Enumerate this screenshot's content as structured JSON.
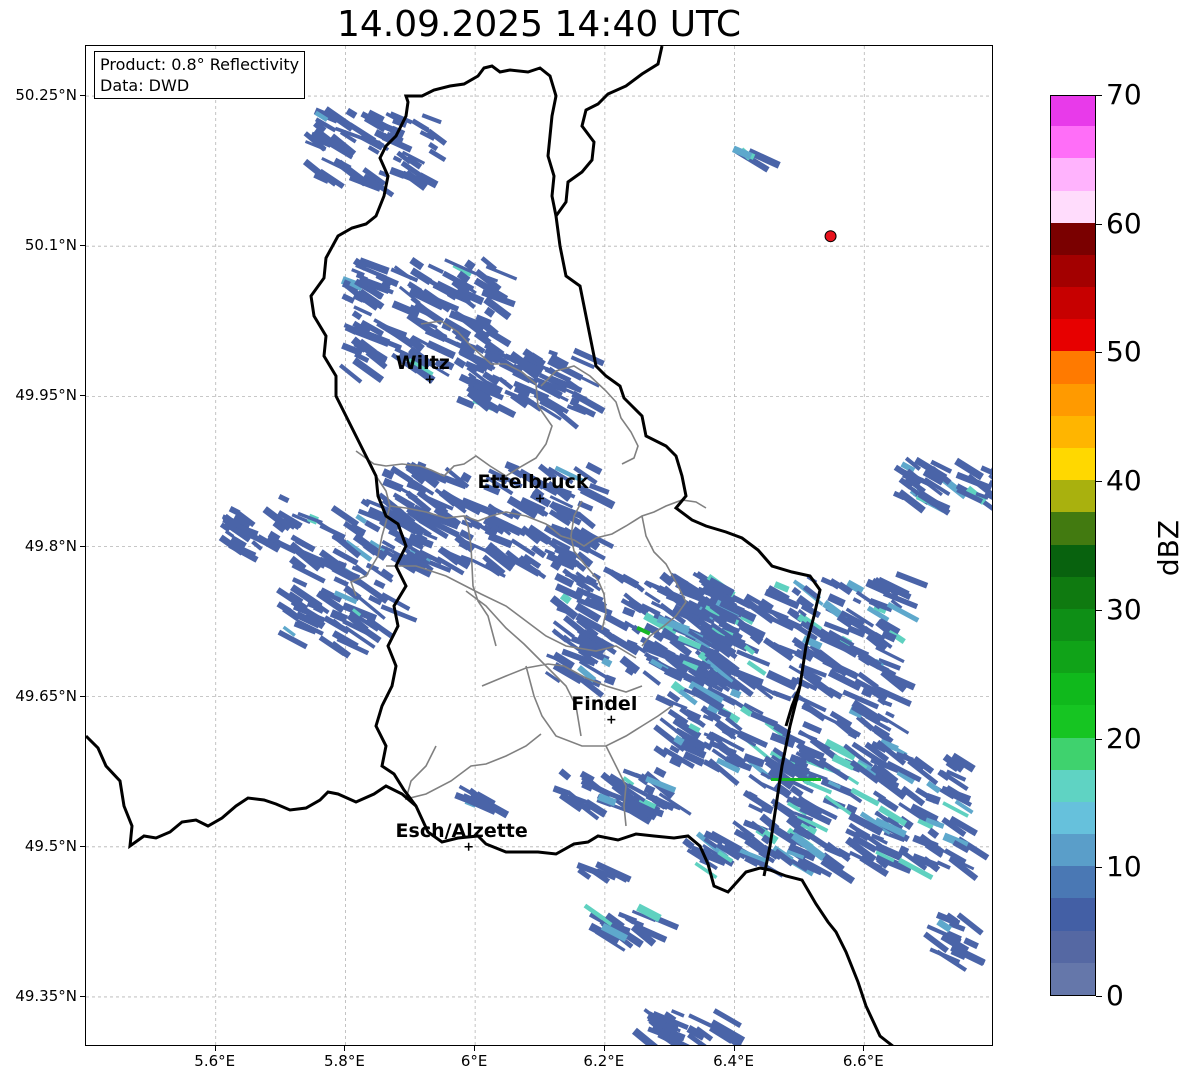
{
  "title": "14.09.2025 14:40 UTC",
  "info_box": {
    "product": "Product: 0.8° Reflectivity",
    "data": "Data: DWD"
  },
  "map": {
    "lon_range": [
      5.4,
      6.8
    ],
    "lat_range": [
      49.3,
      50.3
    ],
    "lon_ticks": [
      {
        "value": 5.6,
        "label": "5.6°E"
      },
      {
        "value": 5.8,
        "label": "5.8°E"
      },
      {
        "value": 6.0,
        "label": "6°E"
      },
      {
        "value": 6.2,
        "label": "6.2°E"
      },
      {
        "value": 6.4,
        "label": "6.4°E"
      },
      {
        "value": 6.6,
        "label": "6.6°E"
      }
    ],
    "lat_ticks": [
      {
        "value": 50.25,
        "label": "50.25°N"
      },
      {
        "value": 50.1,
        "label": "50.1°N"
      },
      {
        "value": 49.95,
        "label": "49.95°N"
      },
      {
        "value": 49.8,
        "label": "49.8°N"
      },
      {
        "value": 49.65,
        "label": "49.65°N"
      },
      {
        "value": 49.5,
        "label": "49.5°N"
      },
      {
        "value": 49.35,
        "label": "49.35°N"
      }
    ],
    "grid": true,
    "cities": [
      {
        "name": "Wiltz",
        "lon": 5.93,
        "lat": 49.967
      },
      {
        "name": "Ettelbruck",
        "lon": 6.1,
        "lat": 49.848
      },
      {
        "name": "Findel",
        "lon": 6.21,
        "lat": 49.627
      },
      {
        "name": "Esch/Alzette",
        "lon": 5.99,
        "lat": 49.5
      }
    ],
    "radar_site": {
      "lon": 6.548,
      "lat": 50.11,
      "color": "#e8121d"
    },
    "echo_colors": {
      "low": "#4a64a8",
      "mid": "#5ea8cc",
      "high": "#5fd1c0",
      "green": "#17b726"
    }
  },
  "colorbar": {
    "label": "dBZ",
    "min": 0,
    "max": 70,
    "step": 2.5,
    "ticks": [
      0,
      10,
      20,
      30,
      40,
      50,
      60,
      70
    ],
    "colors": [
      "#6577aa",
      "#5568a3",
      "#435fa5",
      "#4a78b4",
      "#5a9ec9",
      "#66c1dc",
      "#5fd3c3",
      "#3fd26e",
      "#16c522",
      "#10b91c",
      "#10a318",
      "#0e8f16",
      "#0f7a10",
      "#08620e",
      "#427a10",
      "#a9b10e",
      "#ffd800",
      "#ffb500",
      "#ff9a00",
      "#ff7a00",
      "#e70000",
      "#c70000",
      "#a30000",
      "#7a0000",
      "#ffdcfc",
      "#ffb3fd",
      "#ff6ef8",
      "#e83aea"
    ]
  }
}
